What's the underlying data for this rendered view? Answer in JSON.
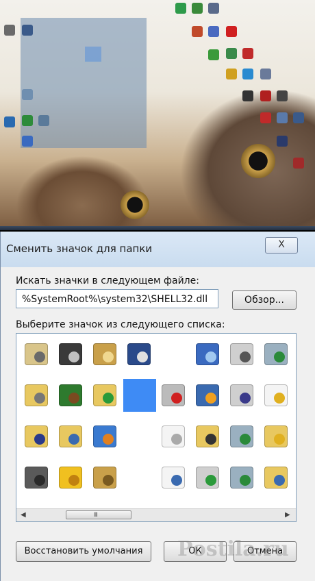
{
  "dialog": {
    "title": "Сменить значок для папки",
    "close_label": "X",
    "search_label": "Искать значки в следующем файле:",
    "file_path": "%SystemRoot%\\system32\\SHELL32.dll",
    "browse_label": "Обзор...",
    "list_label": "Выберите значок из следующего списка:",
    "restore_label": "Восстановить умолчания",
    "ok_label": "ОК",
    "cancel_label": "Отмена",
    "scroll_grip": "III"
  },
  "icons": [
    {
      "name": "control-panel-icon",
      "selected": false
    },
    {
      "name": "cd-drive-icon",
      "selected": false
    },
    {
      "name": "key-icon",
      "selected": false
    },
    {
      "name": "network-settings-icon",
      "selected": false
    },
    {
      "name": "empty-icon",
      "selected": false
    },
    {
      "name": "network-search-icon",
      "selected": false
    },
    {
      "name": "printer-icon",
      "selected": false
    },
    {
      "name": "recycle-bin-icon",
      "selected": false
    },
    {
      "name": "folder-printer-icon",
      "selected": false
    },
    {
      "name": "tree-icon",
      "selected": false
    },
    {
      "name": "folder-upload-icon",
      "selected": false
    },
    {
      "name": "selected-icon",
      "selected": true
    },
    {
      "name": "drive-error-icon",
      "selected": false
    },
    {
      "name": "display-settings-icon",
      "selected": false
    },
    {
      "name": "fax-printer-icon",
      "selected": false
    },
    {
      "name": "document-warning-icon",
      "selected": false
    },
    {
      "name": "folder-fonts-icon",
      "selected": false
    },
    {
      "name": "folder-computer-icon",
      "selected": false
    },
    {
      "name": "windows-globe-icon",
      "selected": false
    },
    {
      "name": "empty-icon",
      "selected": false
    },
    {
      "name": "documents-stack-icon",
      "selected": false
    },
    {
      "name": "folder-printer-2-icon",
      "selected": false
    },
    {
      "name": "recycle-bin-2-icon",
      "selected": false
    },
    {
      "name": "folder-warning-icon",
      "selected": false
    },
    {
      "name": "server-icon",
      "selected": false
    },
    {
      "name": "star-icon",
      "selected": false
    },
    {
      "name": "padlock-icon",
      "selected": false
    },
    {
      "name": "empty-icon",
      "selected": false
    },
    {
      "name": "document-search-icon",
      "selected": false
    },
    {
      "name": "printer-add-icon",
      "selected": false
    },
    {
      "name": "recycle-bin-3-icon",
      "selected": false
    },
    {
      "name": "folder-zip-icon",
      "selected": false
    }
  ],
  "colors": {
    "selection": "#3e8bf5",
    "dialog_bg": "#f0f0f0",
    "titlebar": "#cfdff0"
  },
  "watermark": "Postila.ru"
}
